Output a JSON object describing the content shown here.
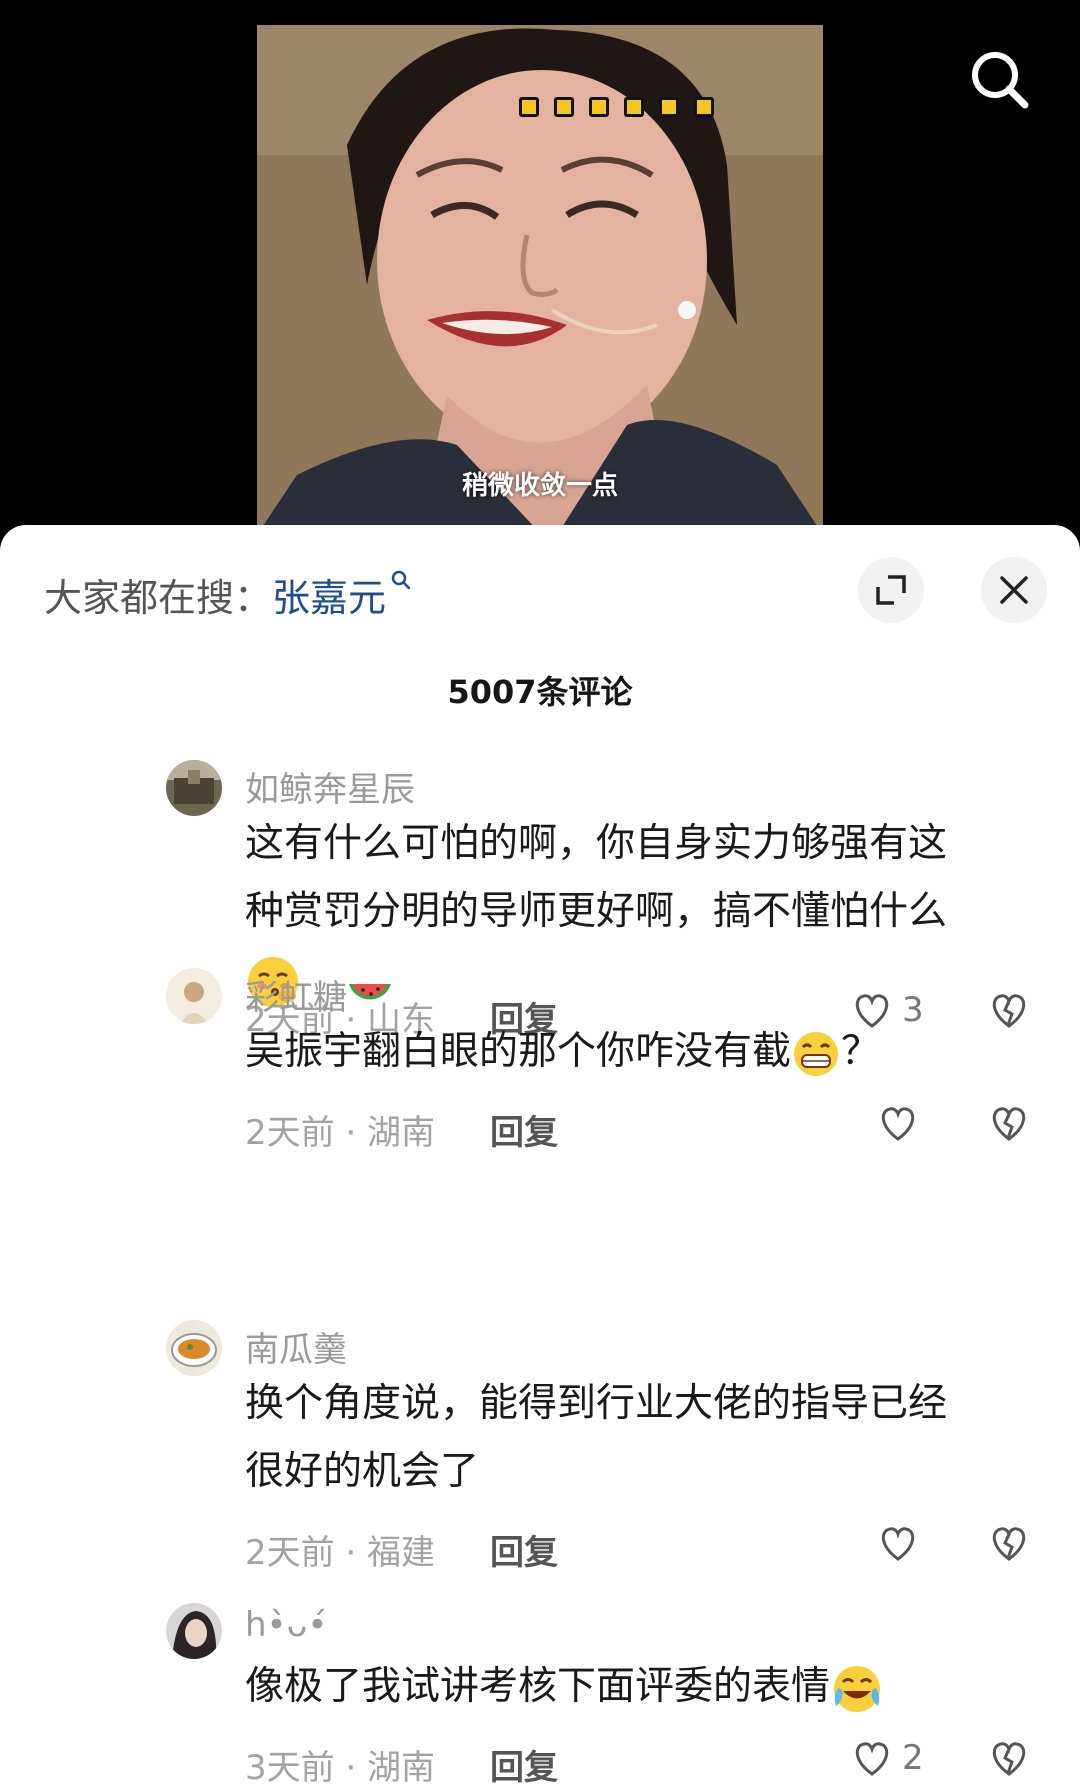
{
  "video": {
    "subtitle": "稍微收敛一点",
    "progress_dots": 6
  },
  "sheet": {
    "hot_search_label": "大家都在搜：",
    "hot_search_term": "张嘉元",
    "comment_count_title": "5007条评论"
  },
  "comments": [
    {
      "username": "如鲸奔星辰",
      "text_line1": "这有什么可怕的啊，你自身实力够强有这",
      "text_line2": "种赏罚分明的导师更好啊，搞不懂怕什么",
      "emoji": "shy-face-emoji",
      "meta": "2天前 · 山东",
      "reply": "回复",
      "likes": "3"
    },
    {
      "username": "彩虹糖",
      "username_emoji": "watermelon-emoji",
      "text": "吴振宇翻白眼的那个你咋没有截",
      "text_suffix": "？",
      "emoji": "grimace-emoji",
      "meta": "2天前 · 湖南",
      "reply": "回复",
      "likes": ""
    },
    {
      "username": "南瓜羹",
      "text_line1": "换个角度说，能得到行业大佬的指导已经",
      "text_line2": "很好的机会了",
      "meta": "2天前 · 福建",
      "reply": "回复",
      "likes": ""
    },
    {
      "username": "h•̀ᴗ•́",
      "text": "像极了我试讲考核下面评委的表情",
      "emoji": "crying-laugh-emoji",
      "meta": "3天前 · 湖南",
      "reply": "回复",
      "likes": "2"
    }
  ],
  "colors": {
    "hot_search_term": "#1e4e8f",
    "progress_dot": "#f3c623",
    "meta_text": "#a3a3a3"
  }
}
